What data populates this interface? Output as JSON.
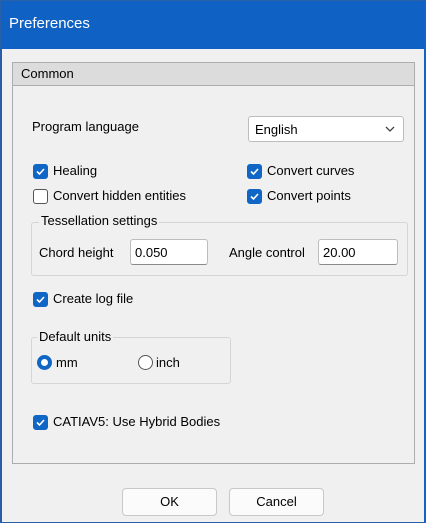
{
  "window": {
    "title": "Preferences"
  },
  "panel": {
    "header": "Common"
  },
  "language": {
    "label": "Program language",
    "selected": "English"
  },
  "options": {
    "healing": {
      "label": "Healing",
      "checked": true
    },
    "convert_curves": {
      "label": "Convert curves",
      "checked": true
    },
    "convert_hidden": {
      "label": "Convert hidden entities",
      "checked": false
    },
    "convert_points": {
      "label": "Convert points",
      "checked": true
    }
  },
  "tessellation": {
    "title": "Tessellation settings",
    "chord_label": "Chord height",
    "chord_value": "0.050",
    "angle_label": "Angle control",
    "angle_value": "20.00"
  },
  "log": {
    "label": "Create log file",
    "checked": true
  },
  "units": {
    "title": "Default units",
    "mm_label": "mm",
    "inch_label": "inch",
    "selected": "mm"
  },
  "catia": {
    "label": "CATIAV5: Use Hybrid Bodies",
    "checked": true
  },
  "buttons": {
    "ok": "OK",
    "cancel": "Cancel"
  },
  "colors": {
    "titlebar": "#0f62c4",
    "accent": "#1066c5"
  }
}
